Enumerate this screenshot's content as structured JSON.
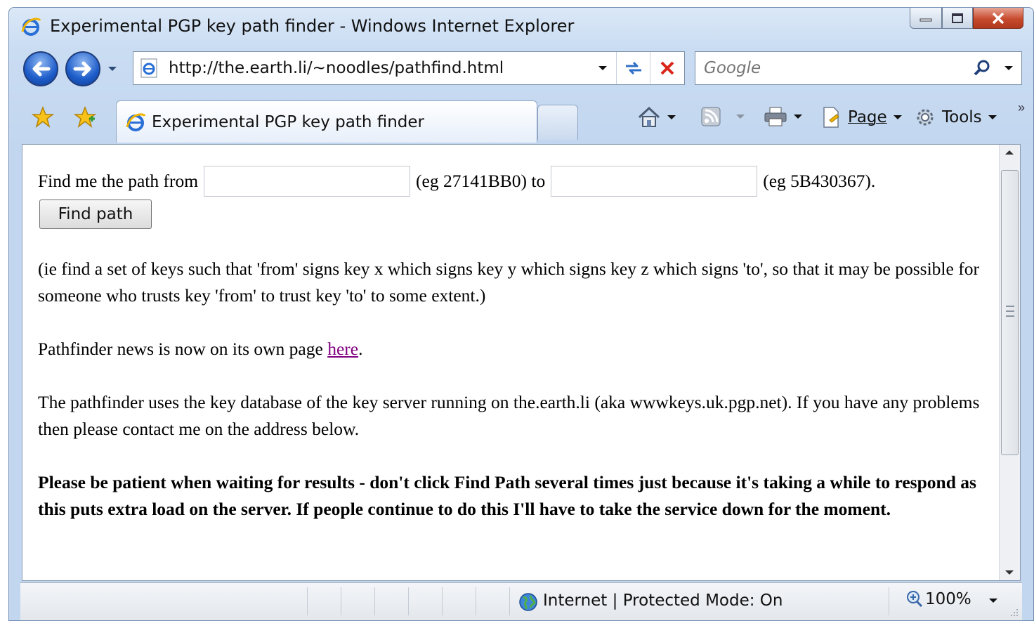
{
  "window": {
    "title": "Experimental PGP key path finder - Windows Internet Explorer"
  },
  "nav": {
    "url": "http://the.earth.li/~noodles/pathfind.html",
    "search_placeholder": "Google"
  },
  "tabs": {
    "active_label": "Experimental PGP key path finder"
  },
  "commands": {
    "page_label": "Page",
    "tools_label": "Tools"
  },
  "content": {
    "form_prefix": "Find me the path from",
    "from_example": "(eg 27141BB0) to",
    "to_example": "(eg 5B430367).",
    "find_button": "Find path",
    "explanation": "(ie find a set of keys such that 'from' signs key x which signs key y which signs key z which signs 'to', so that it may be possible for someone who trusts key 'from' to trust key 'to' to some extent.)",
    "news_prefix": "Pathfinder news is now on its own page ",
    "news_link": "here",
    "news_suffix": ".",
    "database_info": "The pathfinder uses the key database of the key server running on the.earth.li (aka wwwkeys.uk.pgp.net). If you have any problems then please contact me on the address below.",
    "warning": "Please be patient when waiting for results - don't click Find Path several times just because it's taking a while to respond as this puts extra load on the server. If people continue to do this I'll have to take the service down for the moment."
  },
  "status": {
    "zone": "Internet | Protected Mode: On",
    "zoom": "100%"
  },
  "colors": {
    "link_visited": "#800080",
    "close_button": "#c74b2e"
  },
  "icons": [
    "ie-icon",
    "back-arrow-icon",
    "forward-arrow-icon",
    "refresh-icon",
    "stop-icon",
    "search-icon",
    "favorites-star-icon",
    "add-favorites-icon",
    "home-icon",
    "feeds-icon",
    "print-icon",
    "page-icon",
    "tools-gear-icon",
    "globe-icon",
    "zoom-icon"
  ]
}
